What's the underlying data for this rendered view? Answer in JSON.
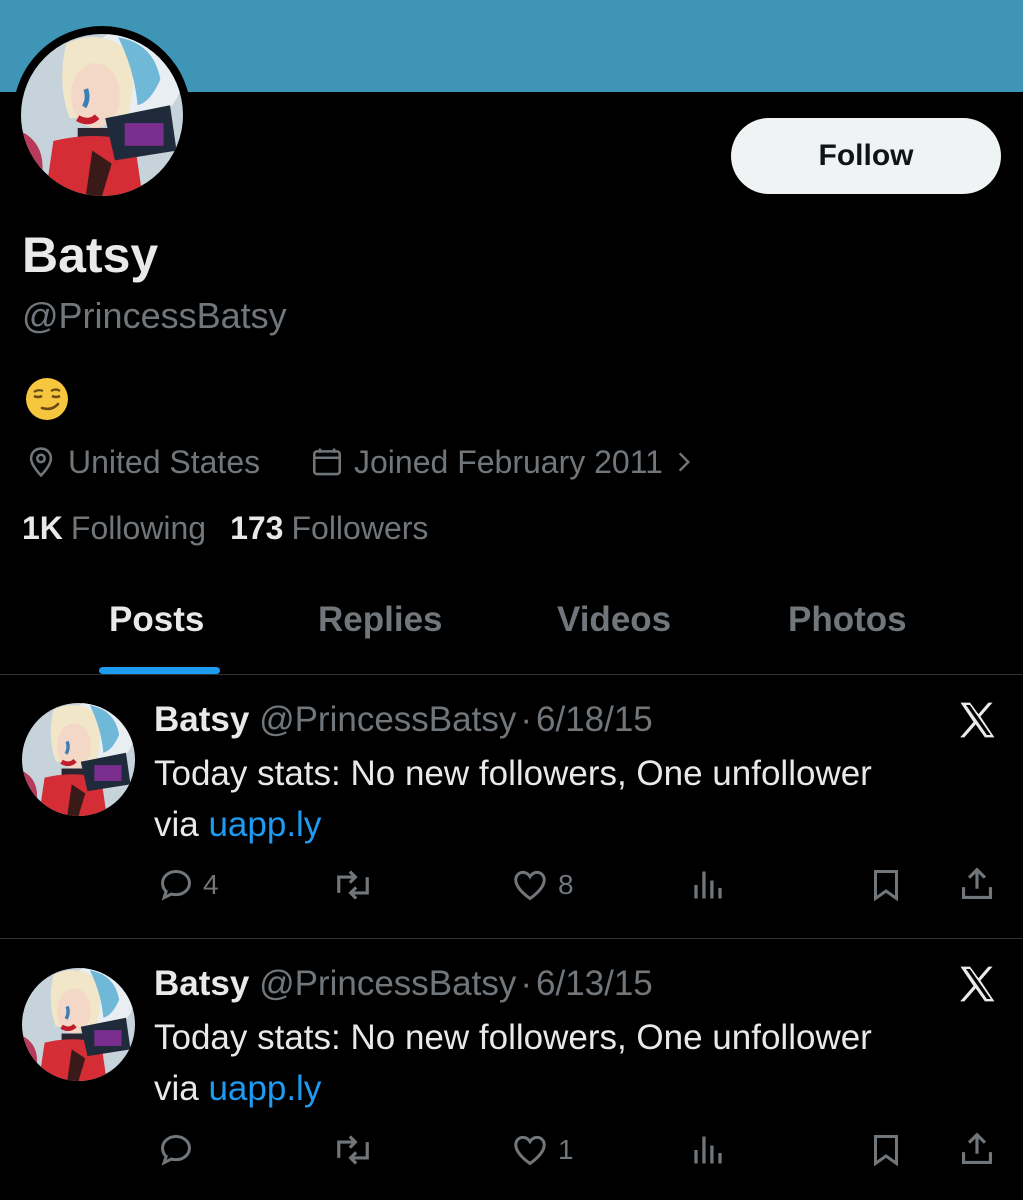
{
  "profile": {
    "display_name": "Batsy",
    "handle": "@PrincessBatsy",
    "bio": "😏",
    "location": "United States",
    "joined": "Joined February 2011",
    "following_count": "1K",
    "following_label": "Following",
    "followers_count": "173",
    "followers_label": "Followers",
    "follow_button": "Follow",
    "banner_color": "#3f95b6"
  },
  "tabs": [
    {
      "label": "Posts",
      "active": true
    },
    {
      "label": "Replies",
      "active": false
    },
    {
      "label": "Videos",
      "active": false
    },
    {
      "label": "Photos",
      "active": false
    }
  ],
  "posts": [
    {
      "name": "Batsy",
      "handle": "@PrincessBatsy",
      "separator": "·",
      "date": "6/18/15",
      "text": "Today stats: No new followers, One unfollower",
      "text_line2_prefix": "via ",
      "link": "uapp.ly",
      "replies": "4",
      "likes": "8"
    },
    {
      "name": "Batsy",
      "handle": "@PrincessBatsy",
      "separator": "·",
      "date": "6/13/15",
      "text": "Today stats: No new followers, One unfollower",
      "text_line2_prefix": "via ",
      "link": "uapp.ly",
      "replies": "",
      "likes": "1"
    }
  ],
  "icons": {
    "location": "map-pin-icon",
    "joined": "calendar-icon",
    "chevron": "chevron-right-icon",
    "x_logo": "x-logo-icon",
    "reply": "reply-icon",
    "repost": "repost-icon",
    "like": "heart-icon",
    "views": "views-icon",
    "bookmark": "bookmark-icon",
    "share": "share-icon"
  },
  "colors": {
    "accent": "#1d9bf0",
    "muted": "#71767b",
    "text": "#e7e9ea",
    "background": "#000000"
  }
}
